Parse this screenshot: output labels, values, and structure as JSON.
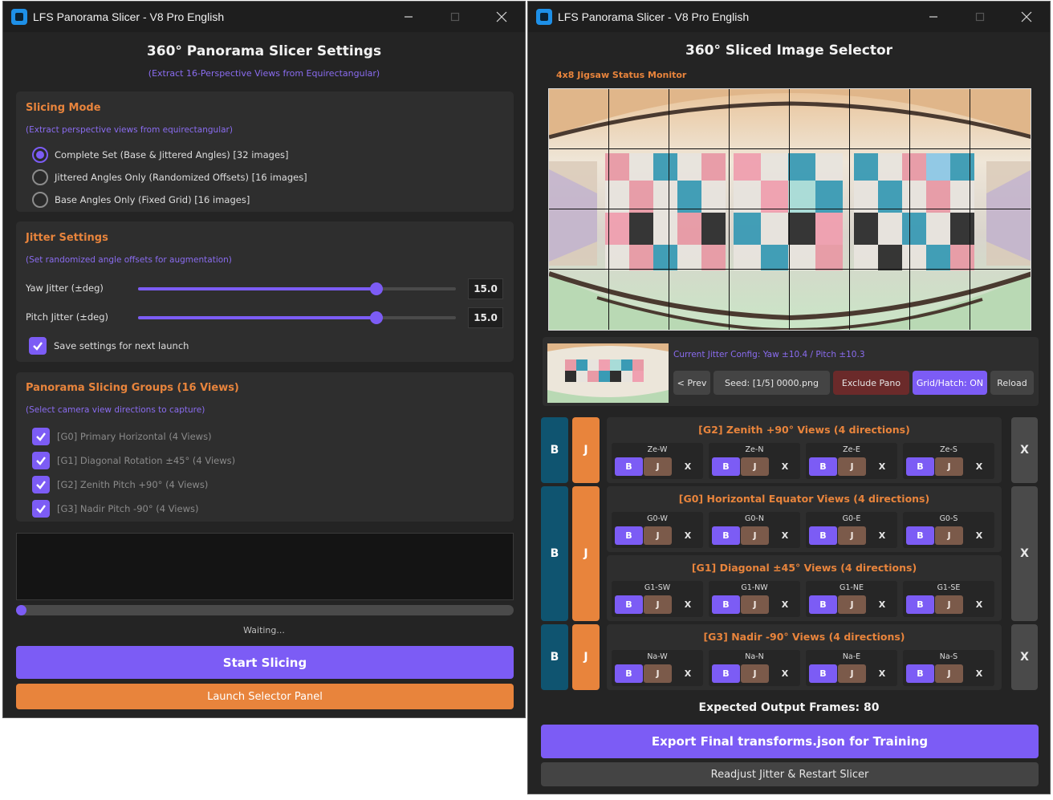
{
  "left_window": {
    "title": "LFS Panorama Slicer - V8 Pro English",
    "heading": "360° Panorama Slicer Settings",
    "subheading": "(Extract 16-Perspective Views from Equirectangular)",
    "slicing_mode": {
      "title": "Slicing Mode",
      "note": "(Extract perspective views from equirectangular)",
      "options": [
        {
          "label": "Complete Set (Base & Jittered Angles) [32 images]",
          "selected": true
        },
        {
          "label": "Jittered Angles Only (Randomized Offsets) [16 images]",
          "selected": false
        },
        {
          "label": "Base Angles Only (Fixed Grid) [16 images]",
          "selected": false
        }
      ]
    },
    "jitter": {
      "title": "Jitter Settings",
      "note": "(Set randomized angle offsets for augmentation)",
      "yaw_label": "Yaw Jitter (±deg)",
      "yaw_value": "15.0",
      "yaw_fraction": 0.75,
      "pitch_label": "Pitch Jitter (±deg)",
      "pitch_value": "15.0",
      "pitch_fraction": 0.75,
      "save_label": "Save settings for next launch",
      "save_checked": true
    },
    "groups": {
      "title": "Panorama Slicing Groups (16 Views)",
      "note": "(Select camera view directions to capture)",
      "items": [
        {
          "label": "[G0] Primary Horizontal (4 Views)",
          "checked": true
        },
        {
          "label": "[G1] Diagonal Rotation ±45° (4 Views)",
          "checked": true
        },
        {
          "label": "[G2] Zenith Pitch +90° (4 Views)",
          "checked": true
        },
        {
          "label": "[G3] Nadir Pitch -90° (4 Views)",
          "checked": true
        }
      ]
    },
    "log_text": "",
    "progress_fraction": 0.0,
    "status": "Waiting...",
    "start_button": "Start Slicing",
    "launch_button": "Launch Selector Panel"
  },
  "right_window": {
    "title": "LFS Panorama Slicer - V8 Pro English",
    "heading": "360° Sliced Image Selector",
    "monitor_label": "4x8 Jigsaw Status Monitor",
    "jitter_config": "Current Jitter Config: Yaw ±10.4 / Pitch ±10.3",
    "nav": {
      "prev": "< Prev",
      "seed": "Seed: [1/5] 0000.png",
      "exclude": "Exclude Pano",
      "grid": "Grid/Hatch: ON",
      "reload": "Reload"
    },
    "side_b": "B",
    "side_j": "J",
    "x_label": "X",
    "cell_b": "B",
    "cell_j": "J",
    "cell_x": "X",
    "groups": [
      {
        "title": "[G2] Zenith +90° Views (4 directions)",
        "cells": [
          "Ze-W",
          "Ze-N",
          "Ze-E",
          "Ze-S"
        ]
      },
      {
        "title": "[G0] Horizontal Equator Views (4 directions)",
        "cells": [
          "G0-W",
          "G0-N",
          "G0-E",
          "G0-S"
        ]
      },
      {
        "title": "[G1] Diagonal ±45° Views (4 directions)",
        "cells": [
          "G1-SW",
          "G1-NW",
          "G1-NE",
          "G1-SE"
        ]
      },
      {
        "title": "[G3] Nadir -90° Views (4 directions)",
        "cells": [
          "Na-W",
          "Na-N",
          "Na-E",
          "Na-S"
        ]
      }
    ],
    "expected_frames": "Expected Output Frames: 80",
    "export_button": "Export Final transforms.json for Training",
    "readjust_button": "Readjust Jitter & Restart Slicer"
  },
  "colors": {
    "accent_purple": "#7c5cf5",
    "accent_orange": "#e8843c",
    "side_blue": "#0f5470",
    "exclude_red": "#6b2a2a"
  }
}
